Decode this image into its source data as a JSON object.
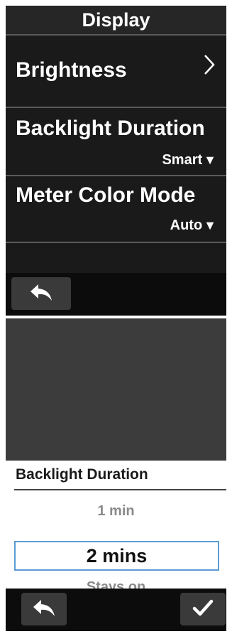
{
  "display_screen": {
    "header_title": "Display",
    "items": [
      {
        "label": "Brightness"
      },
      {
        "label": "Backlight Duration",
        "value": "Smart"
      },
      {
        "label": "Meter Color Mode",
        "value": "Auto"
      }
    ]
  },
  "backlight_picker": {
    "title": "Backlight Duration",
    "options": [
      "1 min",
      "2 mins",
      "Stays on"
    ],
    "selected": "2 mins"
  },
  "icons": [
    "chevron-right-icon",
    "triangle-down-icon",
    "back-arrow-icon",
    "check-icon"
  ],
  "colors": {
    "screen_bg": "#1a1a1a",
    "header_bg": "#262626",
    "button_bg": "#3a3a3a",
    "selection_border": "#5b9bd5"
  }
}
